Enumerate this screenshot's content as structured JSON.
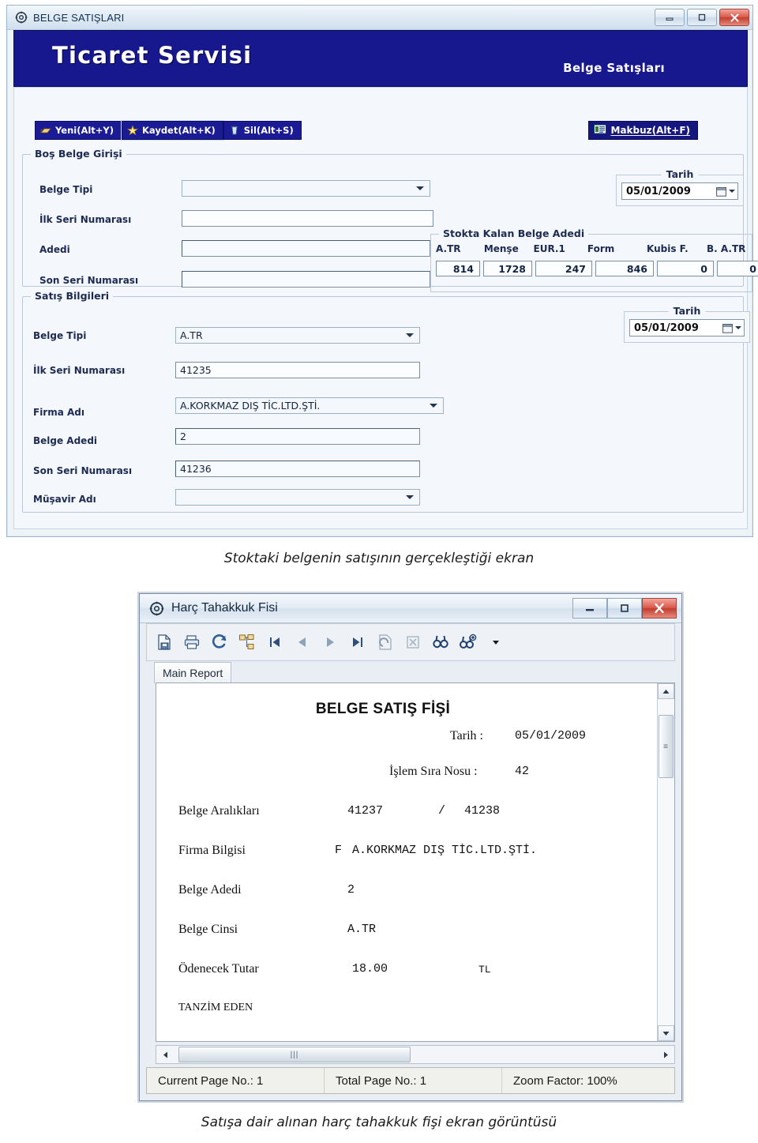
{
  "window1": {
    "title": "BELGE SATIŞLARI",
    "title_icon": "gear-icon",
    "controls": {
      "minimize": "minimize-icon",
      "maximize": "maximize-icon",
      "close": "close-icon"
    },
    "banner": {
      "left": "Ticaret Servisi",
      "right": "Belge Satışları"
    },
    "toolbar": [
      {
        "label": "Yeni(Alt+Y)",
        "icon": "new-document-icon"
      },
      {
        "label": "Kaydet(Alt+K)",
        "icon": "save-star-icon"
      },
      {
        "label": "Sil(Alt+S)",
        "icon": "delete-icon"
      }
    ],
    "makbuz_button": {
      "label": "Makbuz(Alt+F)",
      "icon": "receipt-icon"
    },
    "group_bos": {
      "title": "Boş Belge Girişi",
      "fields": [
        {
          "label": "Belge Tipi",
          "value": "",
          "type": "combo"
        },
        {
          "label": "İlk Seri Numarası",
          "value": "",
          "type": "text"
        },
        {
          "label": "Adedi",
          "value": "",
          "type": "text"
        },
        {
          "label": "Son Seri Numarası",
          "value": "",
          "type": "text"
        }
      ],
      "date": {
        "title": "Tarih",
        "value": "05/01/2009"
      }
    },
    "group_satis": {
      "title": "Satış Bilgileri",
      "fields": [
        {
          "label": "Belge Tipi",
          "value": "A.TR",
          "type": "combo"
        },
        {
          "label": "İlk Seri Numarası",
          "value": "41235",
          "type": "text"
        },
        {
          "label": "Firma Adı",
          "value": "A.KORKMAZ DIŞ TİC.LTD.ŞTİ.",
          "type": "combo"
        },
        {
          "label": "Belge Adedi",
          "value": "2",
          "type": "text"
        },
        {
          "label": "Son Seri Numarası",
          "value": "41236",
          "type": "text"
        },
        {
          "label": "Müşavir Adı",
          "value": "",
          "type": "combo"
        }
      ],
      "date": {
        "title": "Tarih",
        "value": "05/01/2009"
      }
    },
    "stok": {
      "title": "Stokta Kalan Belge Adedi",
      "headers": [
        "A.TR",
        "Menşe",
        "EUR.1",
        "Form",
        "Kubis F.",
        "B. A.TR"
      ],
      "values": [
        "814",
        "1728",
        "247",
        "846",
        "0",
        "0"
      ]
    },
    "colors": {
      "banner": "#17178e",
      "button": "#1b1b96",
      "accent": "#1d2a52"
    }
  },
  "caption1": "Stoktaki belgenin satışının gerçekleştiği ekran",
  "caption2": "Satışa dair alınan harç tahakkuk fişi ekran görüntüsü",
  "window2": {
    "title": "Harç Tahakkuk Fisi",
    "title_icon": "gear-icon",
    "controls": {
      "minimize": "minimize-icon",
      "maximize": "maximize-icon",
      "close": "close-icon"
    },
    "toolbar_icons": [
      "export-icon",
      "print-icon",
      "refresh-icon",
      "toggle-group-tree-icon",
      "first-page-icon",
      "previous-page-icon",
      "next-page-icon",
      "last-page-icon",
      "drill-down-icon",
      "stop-icon",
      "find-icon",
      "zoom-icon",
      "zoom-dropdown-icon"
    ],
    "tab": "Main Report",
    "report": {
      "title": "BELGE SATIŞ FİŞİ",
      "tarih_label": "Tarih :",
      "tarih_value": "05/01/2009",
      "islem_label": "İşlem Sıra Nosu :",
      "islem_value": "42",
      "rows": [
        {
          "label": "Belge Aralıkları",
          "v1": "41237",
          "sep": "/",
          "v2": "41238"
        },
        {
          "label": "Firma Bilgisi",
          "v1": "F",
          "sep": "",
          "v2": "A.KORKMAZ DIŞ TİC.LTD.ŞTİ."
        },
        {
          "label": "Belge Adedi",
          "v1": "2",
          "sep": "",
          "v2": ""
        },
        {
          "label": "Belge Cinsi",
          "v1": "A.TR",
          "sep": "",
          "v2": ""
        },
        {
          "label": "Ödenecek Tutar",
          "v1": "18.00",
          "sep": "",
          "v2": "TL"
        }
      ],
      "footer": "TANZİM EDEN"
    },
    "statusbar": {
      "current_page": "Current Page No.: 1",
      "total_page": "Total Page No.: 1",
      "zoom_factor": "Zoom Factor: 100%"
    }
  }
}
